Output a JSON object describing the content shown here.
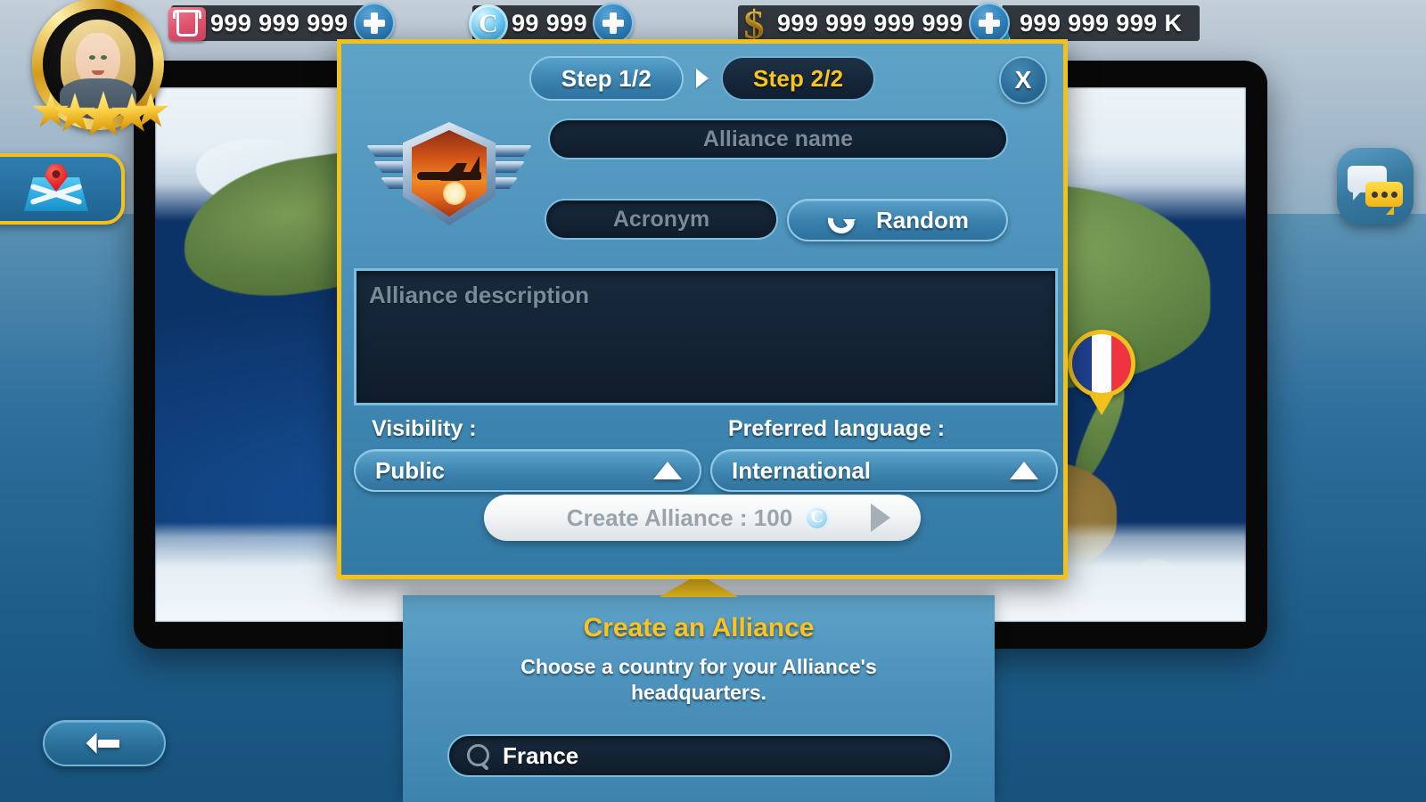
{
  "hud": {
    "resources": [
      {
        "icon": "tshirt-icon",
        "value": "999 999 999",
        "add_label": "+"
      },
      {
        "icon": "coin-icon",
        "value": "99 999",
        "add_label": "+"
      },
      {
        "icon": "dollar-icon",
        "value": "999 999 999 999",
        "add_label": "+"
      },
      {
        "icon": "research-flask-icon",
        "value": "999 999 999 K"
      }
    ]
  },
  "player": {
    "avatar_name": "player-avatar",
    "stars": 5
  },
  "side_buttons": {
    "map_label": "map-icon",
    "chat_label": "chat-icon"
  },
  "back_button": {
    "label": "back-arrow-icon"
  },
  "map_marker": {
    "country": "France"
  },
  "dialog": {
    "steps": [
      {
        "label": "Step 1/2",
        "active": false
      },
      {
        "label": "Step 2/2",
        "active": true
      }
    ],
    "close_label": "X",
    "emblem_name": "alliance-emblem",
    "fields": {
      "alliance_name_placeholder": "Alliance name",
      "acronym_placeholder": "Acronym",
      "description_placeholder": "Alliance description"
    },
    "random_button": {
      "label": "Random"
    },
    "visibility": {
      "label": "Visibility :",
      "value": "Public"
    },
    "language": {
      "label": "Preferred language :",
      "value": "International"
    },
    "create_button": {
      "label": "Create Alliance : 100",
      "coin_glyph": "C",
      "enabled": false
    }
  },
  "bottom_panel": {
    "title": "Create an Alliance",
    "subtitle": "Choose a country for your Alliance's headquarters.",
    "search_value": "France"
  },
  "colors": {
    "accent_yellow": "#f2c11c",
    "panel_blue": "#4e94bd",
    "field_dark": "#132233"
  }
}
